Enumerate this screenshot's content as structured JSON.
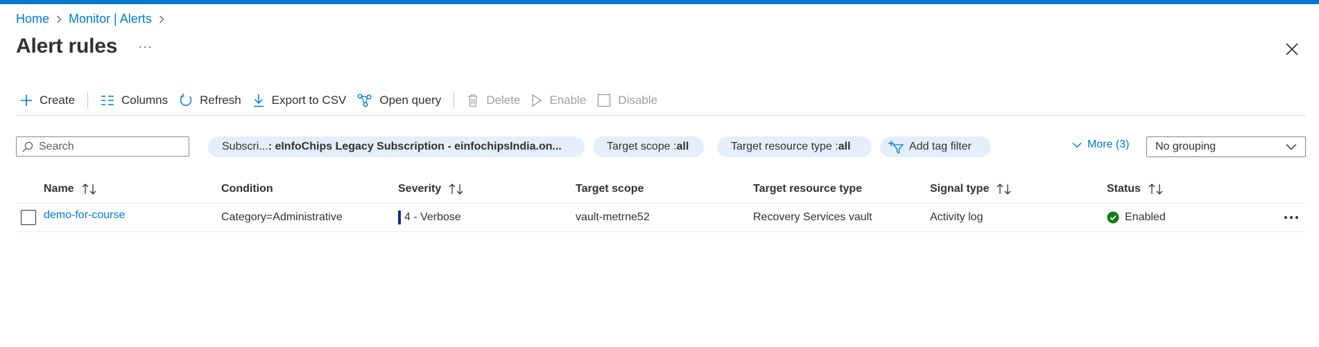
{
  "breadcrumb": {
    "home": "Home",
    "monitor": "Monitor | Alerts"
  },
  "page": {
    "title": "Alert rules",
    "more": "···"
  },
  "toolbar": {
    "create": "Create",
    "columns": "Columns",
    "refresh": "Refresh",
    "export": "Export to CSV",
    "open_query": "Open query",
    "delete": "Delete",
    "enable": "Enable",
    "disable": "Disable"
  },
  "filters": {
    "search_placeholder": "Search",
    "subscription_label": "Subscri... ",
    "subscription_value": ": eInfoChips Legacy Subscription - einfochipsIndia.on...",
    "target_scope_label": "Target scope : ",
    "target_scope_value": "all",
    "target_resource_type_label": "Target resource type : ",
    "target_resource_type_value": "all",
    "add_tag_filter": "Add tag filter",
    "more": "More (3)",
    "grouping": "No grouping"
  },
  "table": {
    "columns": [
      "Name",
      "Condition",
      "Severity",
      "Target scope",
      "Target resource type",
      "Signal type",
      "Status"
    ],
    "rows": [
      {
        "name": "demo-for-course",
        "condition": "Category=Administrative",
        "severity": "4 - Verbose",
        "target_scope": "vault-metrne52",
        "target_resource_type": "Recovery Services vault",
        "signal_type": "Activity log",
        "status": "Enabled"
      }
    ]
  },
  "colors": {
    "accent": "#0078d4",
    "pill_bg": "#e4effa",
    "severity_verbose": "#1c2a8a",
    "status_enabled": "#107c10"
  }
}
